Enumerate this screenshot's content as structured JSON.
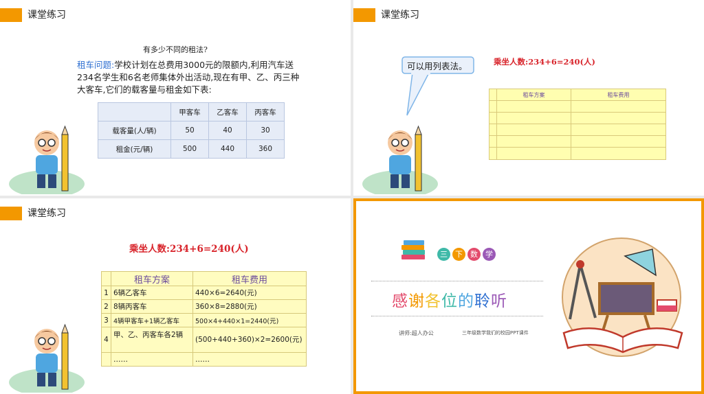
{
  "slides": [
    {
      "header": "课堂练习",
      "question": "有多少不同的租法?",
      "problem_key": "租车问题:",
      "problem_body": "学校计划在总费用3000元的限额内,利用汽车送234名学生和6名老师集体外出活动,现在有甲、乙、丙三种大客车,它们的载客量与租金如下表:",
      "table": {
        "columns": [
          "",
          "甲客车",
          "乙客车",
          "丙客车"
        ],
        "rows": [
          [
            "载客量(人/辆)",
            "50",
            "40",
            "30"
          ],
          [
            "租金(元/辆)",
            "500",
            "440",
            "360"
          ]
        ]
      }
    },
    {
      "header": "课堂练习",
      "bubble": "可以用列表法。",
      "total": "乘坐人数:234+6=240(人)",
      "table": {
        "columns": [
          "租车方案",
          "租车费用"
        ],
        "empty_rows": 5
      }
    },
    {
      "header": "课堂练习",
      "total": "乘坐人数:234+6=240(人)",
      "table": {
        "columns": [
          "租车方案",
          "租车费用"
        ],
        "rows": [
          [
            "1",
            "6辆乙客车",
            "440×6=2640(元)"
          ],
          [
            "2",
            "8辆丙客车",
            "360×8=2880(元)"
          ],
          [
            "3",
            "4辆甲客车+1辆乙客车",
            "500×4+440×1=2440(元)"
          ],
          [
            "4",
            "甲、乙、丙客车各2辆",
            "(500+440+360)×2=2600(元)"
          ],
          [
            "",
            "……",
            "……"
          ]
        ]
      }
    },
    {
      "tags": [
        "三",
        "下",
        "数",
        "学"
      ],
      "tag_colors": [
        "#3fb9a8",
        "#f39800",
        "#e34b6c",
        "#9b59b6"
      ],
      "thanks": "感谢各位的聆听",
      "lecturer": "讲师:超人办公",
      "course": "三年级数学我们的校园PPT课件"
    }
  ],
  "colors": {
    "accent": "#f39800",
    "highlight_blue": "#2e6fd1",
    "total_red": "#d8232a"
  }
}
